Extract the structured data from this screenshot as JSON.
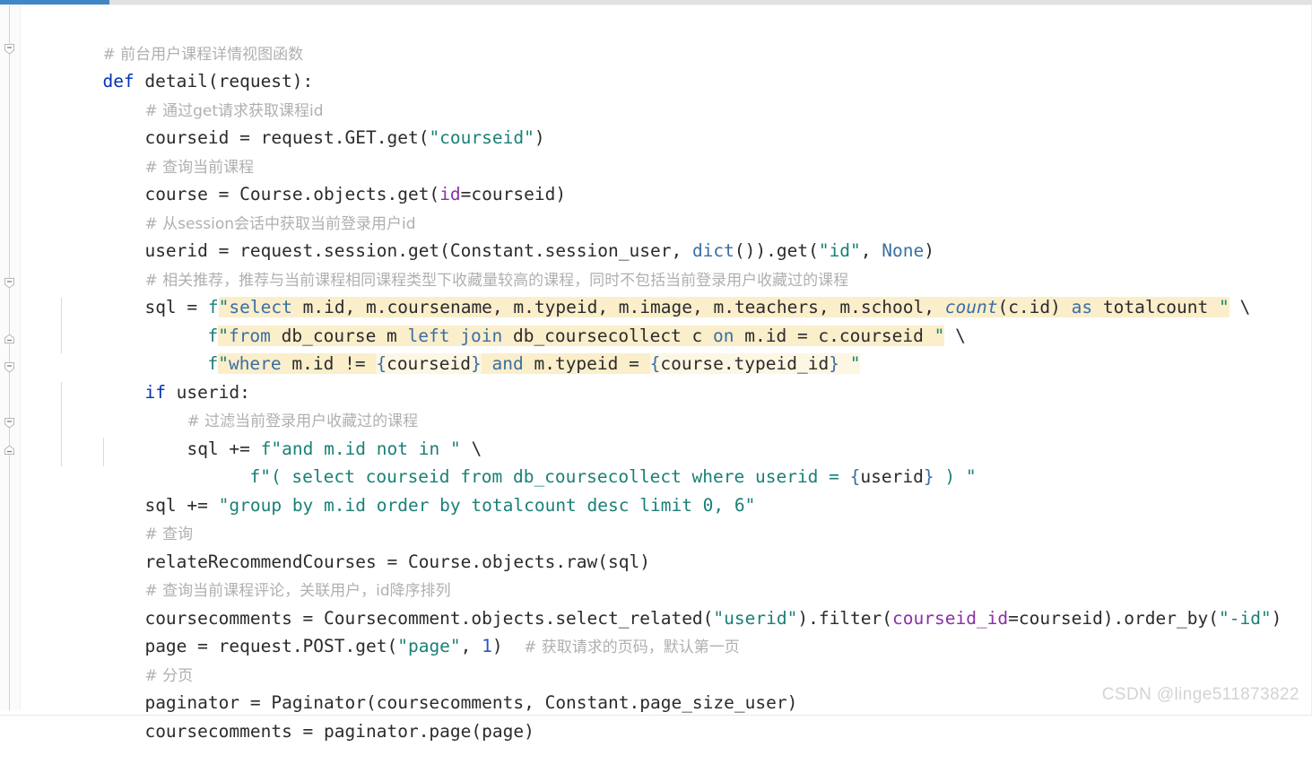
{
  "window": {
    "accent_color": "#4187c6",
    "background": "#ffffff"
  },
  "watermark": {
    "text": "CSDN @linge511873822"
  },
  "theme": {
    "keyword": "#0033b3",
    "builtin": "#3a6ea5",
    "string": "#1a8077",
    "comment": "#b0b0b0",
    "number": "#2b52c9",
    "keyword_arg": "#8c2fa8",
    "sql_keyword": "#3a6ea5",
    "fstring_highlight_bg": "#faeecb",
    "fstring_slot_bg": "#fdf6e3",
    "plain_text": "#2b2b2b",
    "gutter_bg": "#fbfbfb"
  },
  "code": {
    "language": "python",
    "lines": [
      {
        "n": 1,
        "text": "# 前台用户课程详情视图函数"
      },
      {
        "n": 2,
        "text": "def detail(request):"
      },
      {
        "n": 3,
        "text": "    # 通过get请求获取课程id"
      },
      {
        "n": 4,
        "text": "    courseid = request.GET.get(\"courseid\")"
      },
      {
        "n": 5,
        "text": "    # 查询当前课程"
      },
      {
        "n": 6,
        "text": "    course = Course.objects.get(id=courseid)"
      },
      {
        "n": 7,
        "text": "    # 从session会话中获取当前登录用户id"
      },
      {
        "n": 8,
        "text": "    userid = request.session.get(Constant.session_user, dict()).get(\"id\", None)"
      },
      {
        "n": 9,
        "text": "    # 相关推荐，推荐与当前课程相同课程类型下收藏量较高的课程，同时不包括当前登录用户收藏过的课程"
      },
      {
        "n": 10,
        "text": "    sql = f\"select m.id, m.coursename, m.typeid, m.image, m.teachers, m.school, count(c.id) as totalcount \" \\"
      },
      {
        "n": 11,
        "text": "          f\"from db_course m left join db_coursecollect c on m.id = c.courseid \" \\"
      },
      {
        "n": 12,
        "text": "          f\"where m.id != {courseid} and m.typeid = {course.typeid_id} \""
      },
      {
        "n": 13,
        "text": "    if userid:"
      },
      {
        "n": 14,
        "text": "        # 过滤当前登录用户收藏过的课程"
      },
      {
        "n": 15,
        "text": "        sql += f\"and m.id not in \" \\"
      },
      {
        "n": 16,
        "text": "               f\"( select courseid from db_coursecollect where userid = {userid} ) \""
      },
      {
        "n": 17,
        "text": "    sql += \"group by m.id order by totalcount desc limit 0, 6\""
      },
      {
        "n": 18,
        "text": "    # 查询"
      },
      {
        "n": 19,
        "text": "    relateRecommendCourses = Course.objects.raw(sql)"
      },
      {
        "n": 20,
        "text": "    # 查询当前课程评论，关联用户，id降序排列"
      },
      {
        "n": 21,
        "text": "    coursecomments = Coursecomment.objects.select_related(\"userid\").filter(courseid_id=courseid).order_by(\"-id\")"
      },
      {
        "n": 22,
        "text": "    page = request.POST.get(\"page\", 1)  # 获取请求的页码，默认第一页"
      },
      {
        "n": 23,
        "text": "    # 分页"
      },
      {
        "n": 24,
        "text": "    paginator = Paginator(coursecomments, Constant.page_size_user)"
      },
      {
        "n": 25,
        "text": "    coursecomments = paginator.page(page)"
      }
    ]
  },
  "gutter": {
    "fold_markers": [
      {
        "line": 2,
        "state": "expanded",
        "shape": "minus-pointer"
      },
      {
        "line": 10,
        "state": "expanded",
        "shape": "minus-pointer"
      },
      {
        "line": 12,
        "state": "collapsed-end",
        "shape": "minus-flat"
      },
      {
        "line": 13,
        "state": "expanded",
        "shape": "minus-pointer"
      },
      {
        "line": 15,
        "state": "expanded",
        "shape": "minus-pointer"
      },
      {
        "line": 17,
        "state": "collapsed-end",
        "shape": "minus-flat"
      }
    ]
  }
}
